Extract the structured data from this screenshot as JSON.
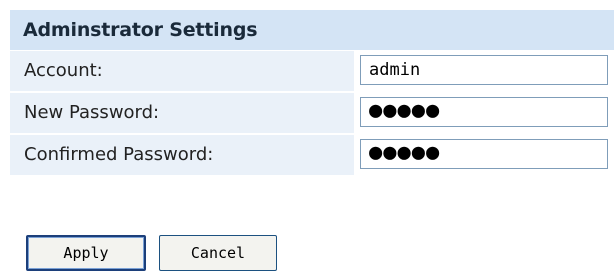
{
  "panel": {
    "title": "Adminstrator Settings",
    "rows": [
      {
        "label": "Account:",
        "value": "admin",
        "type": "text"
      },
      {
        "label": "New Password:",
        "value": "●●●●●",
        "type": "password"
      },
      {
        "label": "Confirmed Password:",
        "value": "●●●●●",
        "type": "password"
      }
    ]
  },
  "actions": {
    "apply_label": "Apply",
    "cancel_label": "Cancel"
  },
  "colors": {
    "header_bg": "#d4e4f5",
    "row_bg": "#eaf1f9",
    "field_border": "#7f9db9",
    "button_border": "#1c5180"
  }
}
